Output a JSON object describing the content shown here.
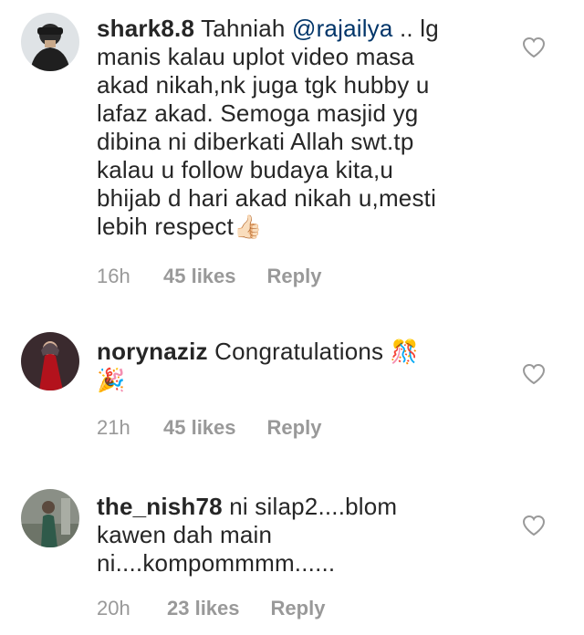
{
  "comments": [
    {
      "username": "shark8.8",
      "text_before": " Tahniah ",
      "mention": "@rajailya",
      "text_after": " .. lg\nmanis kalau uplot video masa\nakad nikah,nk juga tgk hubby u\nlafaz akad. Semoga masjid yg\ndibina ni diberkati Allah swt.tp\nkalau u follow budaya kita,u\nbhijab d hari akad nikah u,mesti\nlebih respect",
      "emoji": "👍🏻",
      "time": "16h",
      "likes": "45 likes",
      "reply": "Reply"
    },
    {
      "username": "norynaziz",
      "text_before": " Congratulations ",
      "mention": "",
      "text_after": "",
      "emoji": "🎊\n🎉",
      "time": "21h",
      "likes": "45 likes",
      "reply": "Reply"
    },
    {
      "username": "the_nish78",
      "text_before": " ni silap2....blom\nkawen dah main\nni....kompommmm......",
      "mention": "",
      "text_after": "",
      "emoji": "",
      "time": "20h",
      "likes": "23 likes",
      "reply": "Reply"
    }
  ],
  "icons": {
    "like": "heart-outline-icon"
  },
  "colors": {
    "mention": "#003569",
    "meta": "#999999",
    "text": "#262626"
  }
}
